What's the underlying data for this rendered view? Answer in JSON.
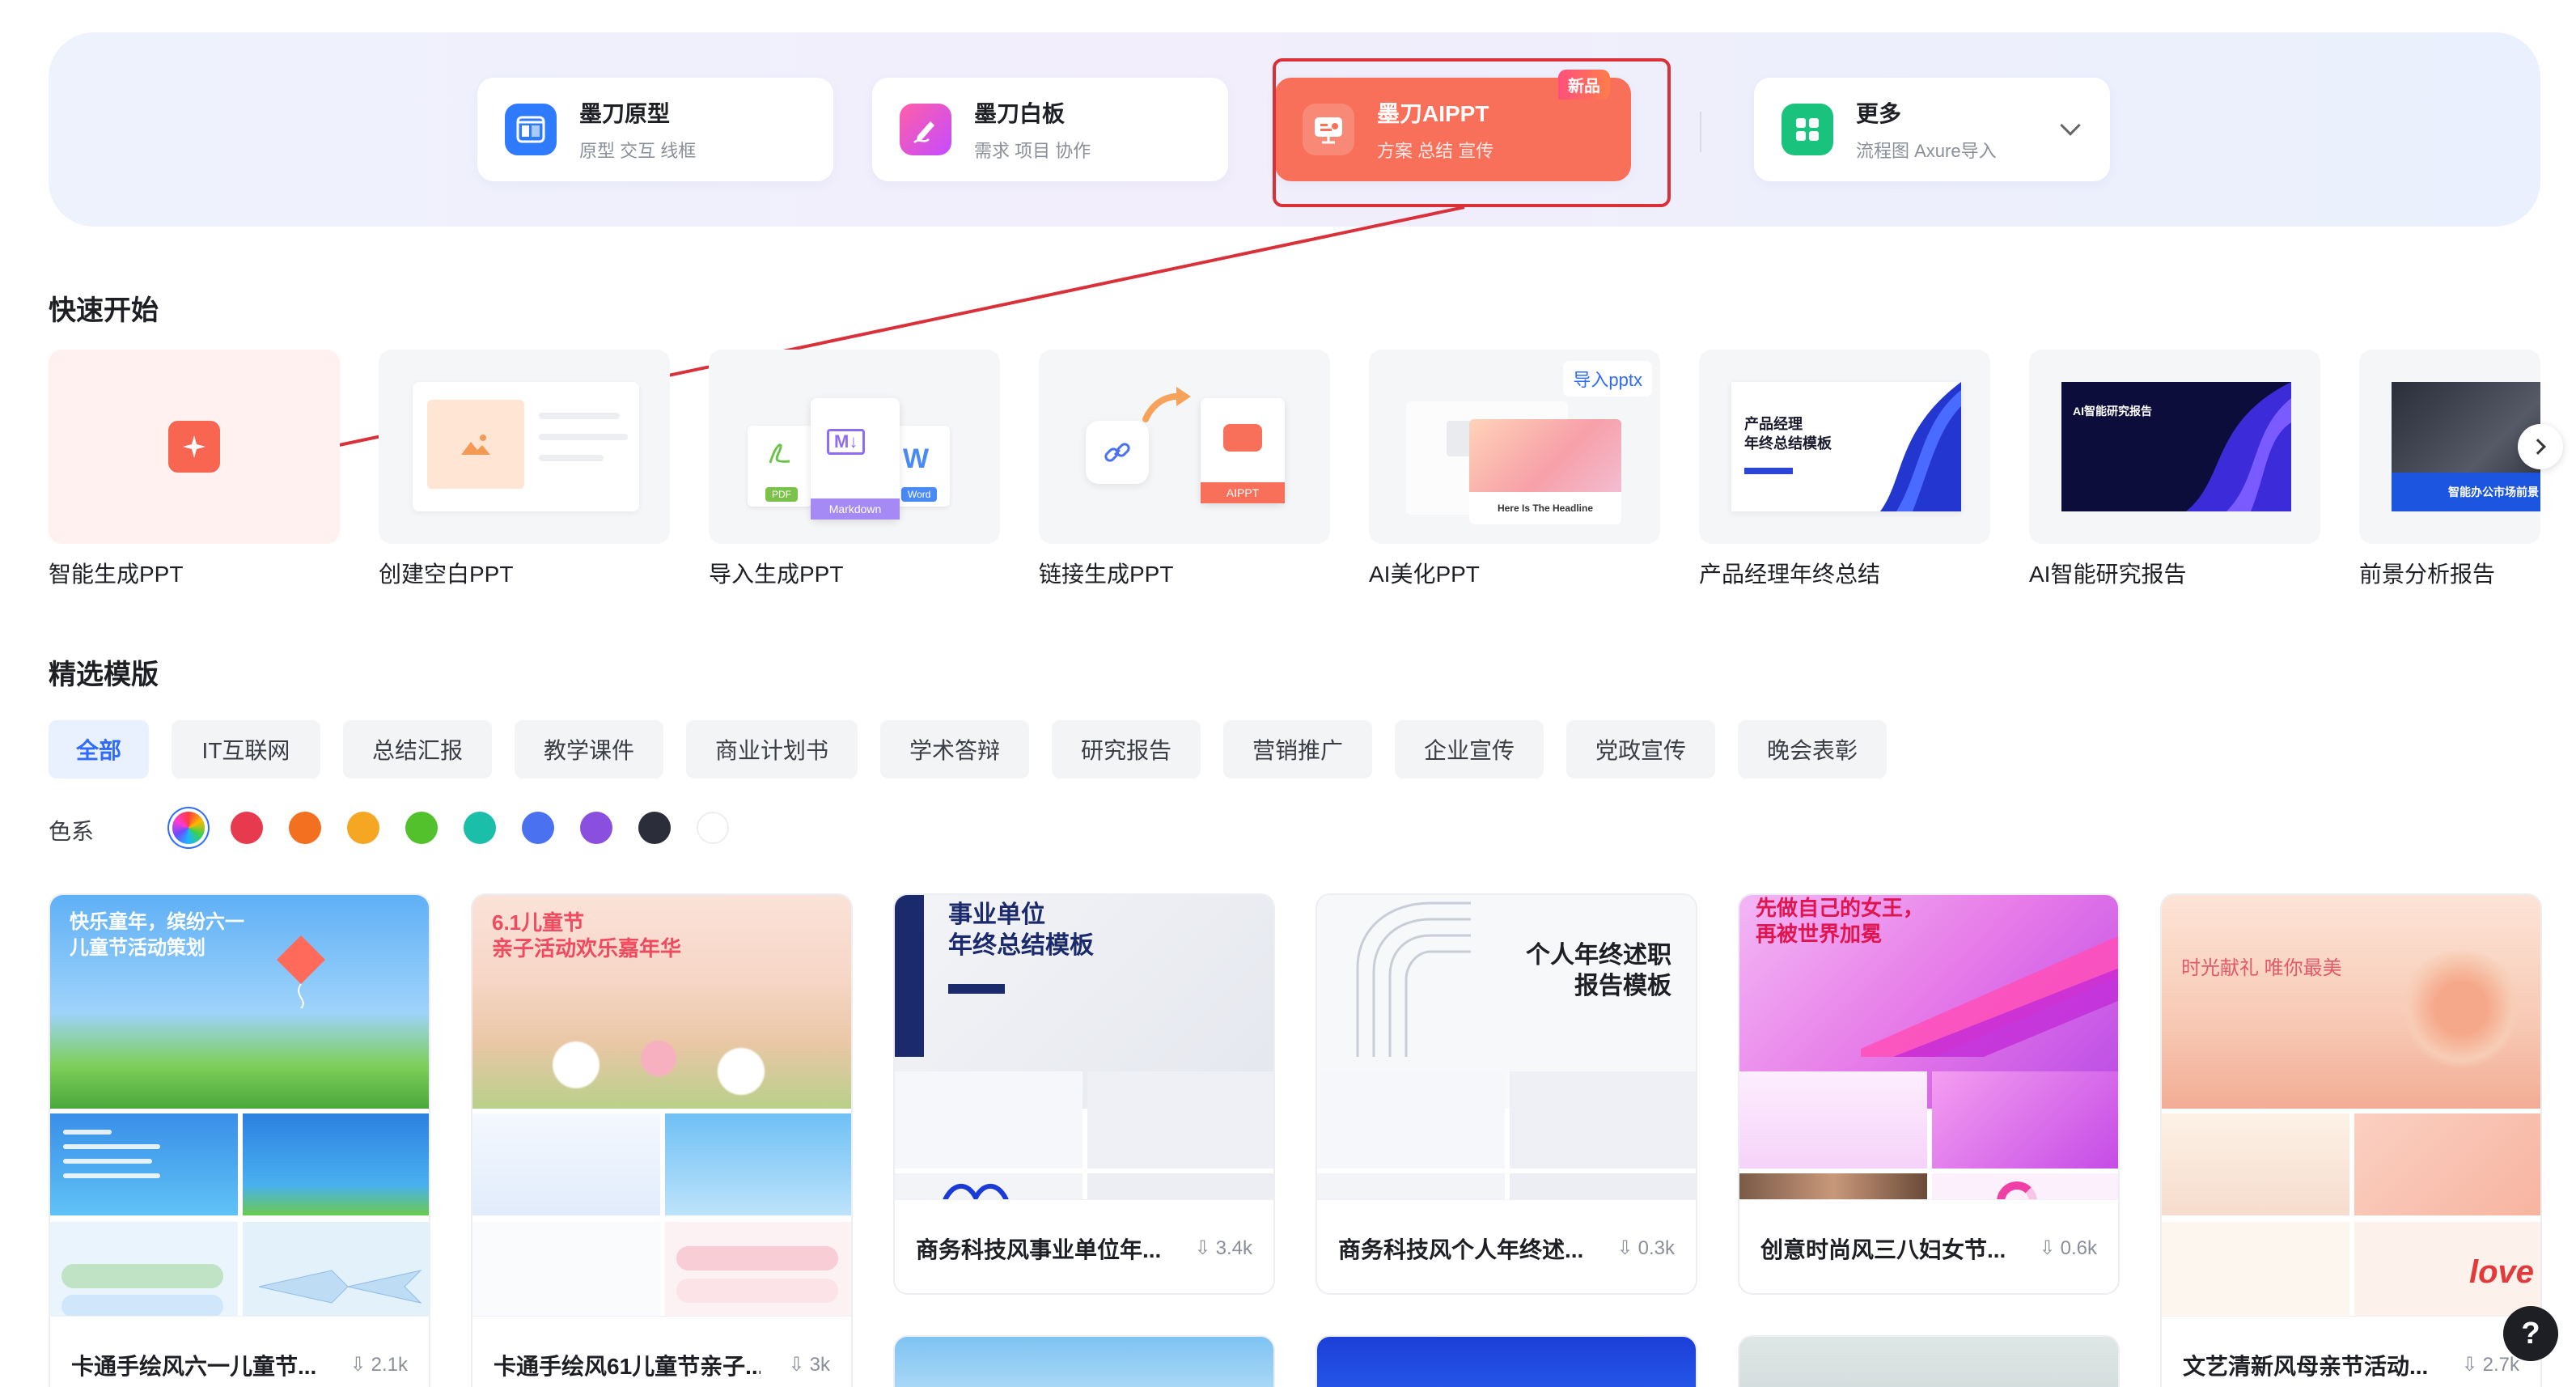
{
  "products": [
    {
      "name": "墨刀原型",
      "sub": "原型 交互 线框",
      "icon": "prototype-icon",
      "color": "#2f7bff"
    },
    {
      "name": "墨刀白板",
      "sub": "需求 项目 协作",
      "icon": "whiteboard-icon",
      "color": "#ee4fc0"
    },
    {
      "name": "墨刀AIPPT",
      "sub": "方案 总结 宣传",
      "icon": "aippt-icon",
      "color": "#f86f5a",
      "badge": "新品",
      "active": true
    },
    {
      "name": "更多",
      "sub": "流程图 Axure导入",
      "icon": "grid-icon",
      "color": "#19c37d"
    }
  ],
  "quick_start": {
    "title": "快速开始",
    "items": [
      {
        "label": "智能生成PPT"
      },
      {
        "label": "创建空白PPT"
      },
      {
        "label": "导入生成PPT",
        "tags": [
          "PDF",
          "Markdown",
          "Word"
        ]
      },
      {
        "label": "链接生成PPT",
        "tag": "AIPPT"
      },
      {
        "label": "AI美化PPT",
        "badge": "导入pptx",
        "headline": "Here Is The Headline"
      },
      {
        "label": "产品经理年终总结",
        "thumb_title": "产品经理\n年终总结模板"
      },
      {
        "label": "AI智能研究报告",
        "thumb_title": "AI智能研究报告"
      },
      {
        "label": "前景分析报告",
        "thumb_title": "智能办公市场前景"
      }
    ]
  },
  "templates_section": {
    "title": "精选模版",
    "categories": [
      "全部",
      "IT互联网",
      "总结汇报",
      "教学课件",
      "商业计划书",
      "学术答辩",
      "研究报告",
      "营销推广",
      "企业宣传",
      "党政宣传",
      "晚会表彰"
    ],
    "color_label": "色系",
    "colors": [
      "#e83a4f",
      "#f2701f",
      "#f5a623",
      "#52c12b",
      "#1bbfa9",
      "#4a72f0",
      "#8b4fe0",
      "#2b2d3a",
      "#ffffff"
    ]
  },
  "templates": [
    {
      "title": "卡通手绘风六一儿童节...",
      "downloads": "2.1k",
      "cover": "快乐童年，缤纷六一\n儿童节活动策划"
    },
    {
      "title": "卡通手绘风61儿童节亲子...",
      "downloads": "3k",
      "cover": "6.1儿童节\n亲子活动欢乐嘉年华"
    },
    {
      "title": "商务科技风事业单位年...",
      "downloads": "3.4k",
      "cover": "事业单位\n年终总结模板"
    },
    {
      "title": "商务科技风个人年终述...",
      "downloads": "0.3k",
      "cover": "个人年终述职\n报告模板"
    },
    {
      "title": "创意时尚风三八妇女节...",
      "downloads": "0.6k",
      "cover": "先做自己的女王，\n再被世界加冕"
    },
    {
      "title": "文艺清新风母亲节活动...",
      "downloads": "2.7k",
      "cover": "时光献礼 唯你最美"
    }
  ],
  "help_label": "?"
}
